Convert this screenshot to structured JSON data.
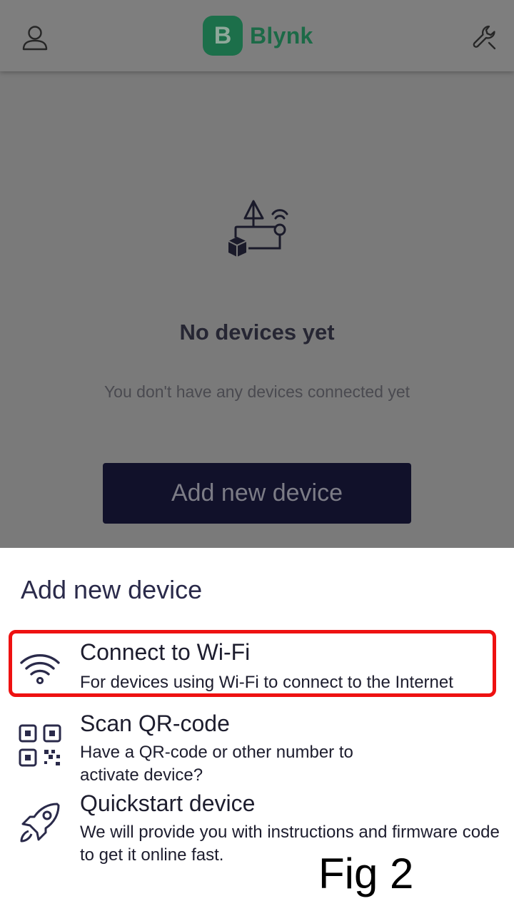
{
  "app": {
    "logo_letter": "B",
    "logo_text": "Blynk",
    "brand_color": "#1c6f4a"
  },
  "header": {
    "profile_icon": "user-icon",
    "settings_icon": "wrench-icon"
  },
  "empty_state": {
    "illustration_icon": "devices-illustration-icon",
    "title": "No devices yet",
    "subtitle": "You don't have any devices connected yet",
    "button_label": "Add new device"
  },
  "sheet": {
    "title": "Add new device",
    "options": [
      {
        "icon": "wifi-icon",
        "title": "Connect to Wi-Fi",
        "description": "For devices using Wi-Fi to connect to the Internet"
      },
      {
        "icon": "qr-code-icon",
        "title": "Scan QR-code",
        "description": "Have a QR-code or other number to activate device?"
      },
      {
        "icon": "rocket-icon",
        "title": "Quickstart device",
        "description": "We will provide you with instructions and firmware code to get it online fast."
      }
    ]
  },
  "annotation": {
    "figure_label": "Fig 2",
    "highlight_color": "#ee1111"
  }
}
